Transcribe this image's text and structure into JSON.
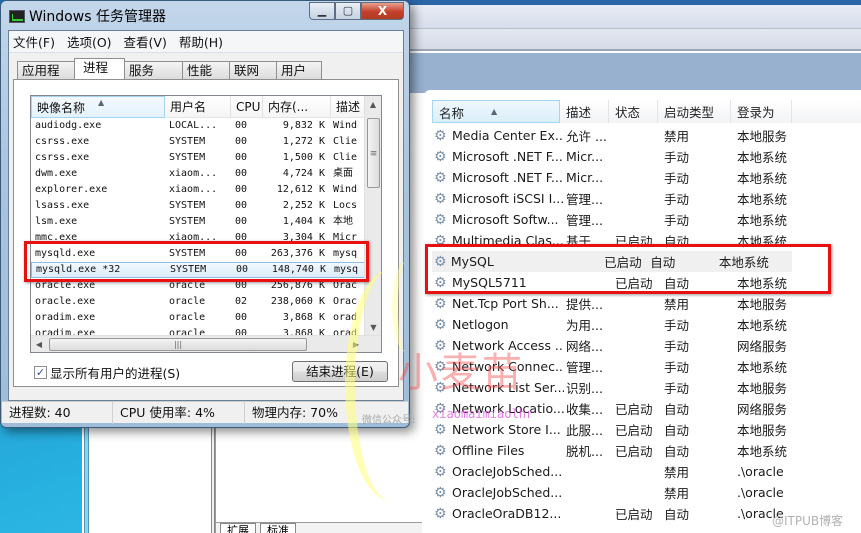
{
  "task_manager": {
    "title": "Windows 任务管理器",
    "controls": {
      "minimize": "▁",
      "maximize": "▢",
      "close": "X"
    },
    "menu": [
      "文件(F)",
      "选项(O)",
      "查看(V)",
      "帮助(H)"
    ],
    "tabs": [
      {
        "label": "应用程序",
        "active": false
      },
      {
        "label": "进程",
        "active": true
      },
      {
        "label": "服务",
        "active": false
      },
      {
        "label": "性能",
        "active": false
      },
      {
        "label": "联网",
        "active": false
      },
      {
        "label": "用户",
        "active": false
      }
    ],
    "columns": [
      "映像名称",
      "用户名",
      "CPU",
      "内存(...",
      "描述"
    ],
    "processes": [
      {
        "name": "audiodg.exe",
        "user": "LOCAL...",
        "cpu": "00",
        "mem": "9,832 K",
        "desc": "Wind"
      },
      {
        "name": "csrss.exe",
        "user": "SYSTEM",
        "cpu": "00",
        "mem": "1,272 K",
        "desc": "Clie"
      },
      {
        "name": "csrss.exe",
        "user": "SYSTEM",
        "cpu": "00",
        "mem": "1,500 K",
        "desc": "Clie"
      },
      {
        "name": "dwm.exe",
        "user": "xiaom...",
        "cpu": "00",
        "mem": "4,724 K",
        "desc": "桌面"
      },
      {
        "name": "explorer.exe",
        "user": "xiaom...",
        "cpu": "00",
        "mem": "12,612 K",
        "desc": "Wind"
      },
      {
        "name": "lsass.exe",
        "user": "SYSTEM",
        "cpu": "00",
        "mem": "2,252 K",
        "desc": "Locs"
      },
      {
        "name": "lsm.exe",
        "user": "SYSTEM",
        "cpu": "00",
        "mem": "1,404 K",
        "desc": "本地"
      },
      {
        "name": "mmc.exe",
        "user": "xiaom...",
        "cpu": "00",
        "mem": "3,304 K",
        "desc": "Micr"
      },
      {
        "name": "mysqld.exe",
        "user": "SYSTEM",
        "cpu": "00",
        "mem": "263,376 K",
        "desc": "mysq"
      },
      {
        "name": "mysqld.exe *32",
        "user": "SYSTEM",
        "cpu": "00",
        "mem": "148,740 K",
        "desc": "mysq"
      },
      {
        "name": "oracle.exe",
        "user": "oracle",
        "cpu": "00",
        "mem": "256,876 K",
        "desc": "Orac"
      },
      {
        "name": "oracle.exe",
        "user": "oracle",
        "cpu": "02",
        "mem": "238,060 K",
        "desc": "Orac"
      },
      {
        "name": "oradim.exe",
        "user": "oracle",
        "cpu": "00",
        "mem": "3,868 K",
        "desc": "orad"
      },
      {
        "name": "oradim.exe",
        "user": "oracle",
        "cpu": "00",
        "mem": "3,868 K",
        "desc": "orad"
      }
    ],
    "selected_process_index": 9,
    "show_all_users_label": "显示所有用户的进程(S)",
    "show_all_users_checked": true,
    "end_process_label": "结束进程(E)",
    "status": {
      "process_count": "进程数: 40",
      "cpu_usage": "CPU 使用率: 4%",
      "physical_memory": "物理内存: 70%"
    }
  },
  "services": {
    "columns": [
      "名称",
      "描述",
      "状态",
      "启动类型",
      "登录为"
    ],
    "rows": [
      {
        "name": "Media Center Ex...",
        "desc": "允许 ...",
        "state": "",
        "startup": "禁用",
        "logon": "本地服务"
      },
      {
        "name": "Microsoft .NET F...",
        "desc": "Micr...",
        "state": "",
        "startup": "手动",
        "logon": "本地系统"
      },
      {
        "name": "Microsoft .NET F...",
        "desc": "Micr...",
        "state": "",
        "startup": "手动",
        "logon": "本地系统"
      },
      {
        "name": "Microsoft iSCSI I...",
        "desc": "管理...",
        "state": "",
        "startup": "手动",
        "logon": "本地系统"
      },
      {
        "name": "Microsoft Softw...",
        "desc": "管理...",
        "state": "",
        "startup": "手动",
        "logon": "本地系统"
      },
      {
        "name": "Multimedia Clas...",
        "desc": "基于...",
        "state": "已启动",
        "startup": "自动",
        "logon": "本地系统"
      },
      {
        "name": "MySQL",
        "desc": "",
        "state": "已启动",
        "startup": "自动",
        "logon": "本地系统"
      },
      {
        "name": "MySQL5711",
        "desc": "",
        "state": "已启动",
        "startup": "自动",
        "logon": "本地系统"
      },
      {
        "name": "Net.Tcp Port Sh...",
        "desc": "提供...",
        "state": "",
        "startup": "禁用",
        "logon": "本地服务"
      },
      {
        "name": "Netlogon",
        "desc": "为用...",
        "state": "",
        "startup": "手动",
        "logon": "本地系统"
      },
      {
        "name": "Network Access ...",
        "desc": "网络...",
        "state": "",
        "startup": "手动",
        "logon": "网络服务"
      },
      {
        "name": "Network Connec...",
        "desc": "管理...",
        "state": "",
        "startup": "手动",
        "logon": "本地系统"
      },
      {
        "name": "Network List Ser...",
        "desc": "识别...",
        "state": "",
        "startup": "手动",
        "logon": "本地服务"
      },
      {
        "name": "Network Locatio...",
        "desc": "收集...",
        "state": "已启动",
        "startup": "自动",
        "logon": "网络服务"
      },
      {
        "name": "Network Store I...",
        "desc": "此服...",
        "state": "已启动",
        "startup": "自动",
        "logon": "本地服务"
      },
      {
        "name": "Offline Files",
        "desc": "脱机...",
        "state": "已启动",
        "startup": "自动",
        "logon": "本地系统"
      },
      {
        "name": "OracleJobSched...",
        "desc": "",
        "state": "",
        "startup": "禁用",
        "logon": ".\\oracle"
      },
      {
        "name": "OracleJobSched...",
        "desc": "",
        "state": "",
        "startup": "禁用",
        "logon": ".\\oracle"
      },
      {
        "name": "OracleOraDB12...",
        "desc": "",
        "state": "已启动",
        "startup": "自动",
        "logon": ".\\oracle"
      }
    ],
    "bottom_tabs": [
      "扩展",
      "标准"
    ]
  },
  "watermark": {
    "big_text": "小麦苗",
    "wechat_label": "微信公众号:",
    "wechat_id": "xiaomaimiaolhr",
    "site": "@ITPUB博客"
  },
  "colors": {
    "highlight_box": "#e81010",
    "accent_blue": "#2b66a8"
  }
}
